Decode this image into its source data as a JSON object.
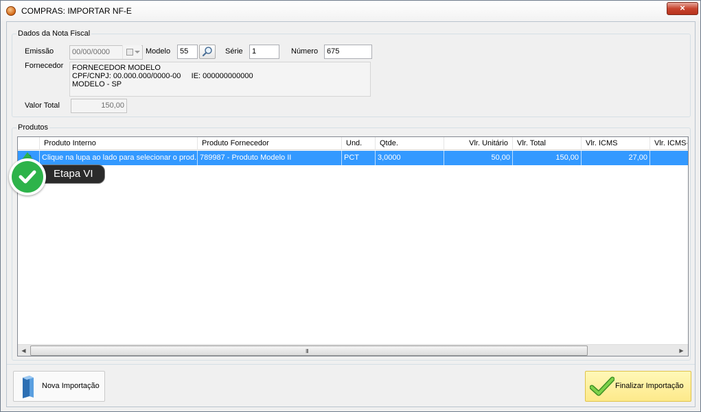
{
  "window": {
    "title": "COMPRAS: IMPORTAR NF-E",
    "close_label": "×"
  },
  "nota": {
    "legend": "Dados da Nota Fiscal",
    "emissao_label": "Emissão",
    "emissao_value": "00/00/0000",
    "modelo_label": "Modelo",
    "modelo_value": "55",
    "serie_label": "Série",
    "serie_value": "1",
    "numero_label": "Número",
    "numero_value": "675",
    "fornecedor_label": "Fornecedor",
    "fornecedor_lines": [
      "FORNECEDOR MODELO",
      "CPF/CNPJ: 00.000.000/0000-00     IE: 000000000000",
      "MODELO - SP"
    ],
    "valor_total_label": "Valor Total",
    "valor_total_value": "150,00"
  },
  "produtos": {
    "legend": "Produtos",
    "columns": [
      "Produto Interno",
      "Produto Fornecedor",
      "Und.",
      "Qtde.",
      "Vlr. Unitário",
      "Vlr. Total",
      "Vlr. ICMS",
      "Vlr. ICMS-"
    ],
    "row": {
      "produto_interno": "Clique na lupa ao lado para selecionar o prod...",
      "produto_fornecedor": "789987 - Produto Modelo II",
      "und": "PCT",
      "qtde": "3,0000",
      "vlr_unitario": "50,00",
      "vlr_total": "150,00",
      "vlr_icms": "27,00",
      "vlr_icms_st": ""
    },
    "scroll_grip": "III"
  },
  "callout": {
    "label": "Etapa VI"
  },
  "buttons": {
    "nova_importacao": "Nova Importação",
    "finalizar_importacao": "Finalizar Importação"
  },
  "colors": {
    "selection": "#3399ff",
    "callout_green": "#2db34a",
    "finish_bg": "#fde98a"
  }
}
